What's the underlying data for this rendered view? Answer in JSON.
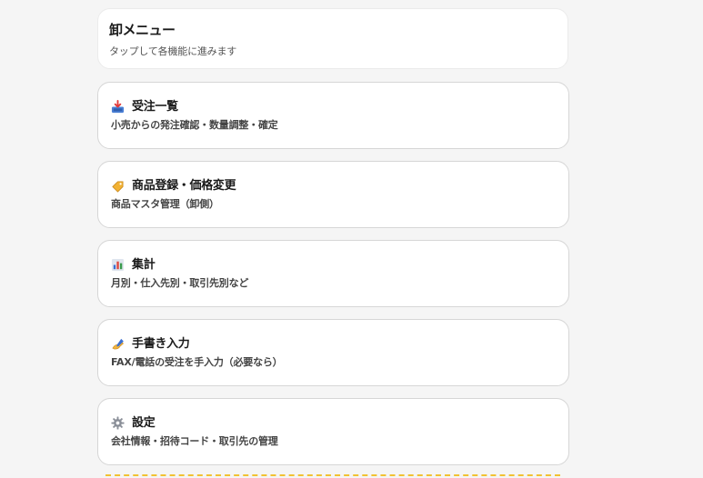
{
  "header": {
    "title": "卸メニュー",
    "subtitle": "タップして各機能に進みます"
  },
  "menu": [
    {
      "icon": "inbox-tray-icon",
      "title": "受注一覧",
      "desc": "小売からの発注確認・数量調整・確定"
    },
    {
      "icon": "price-tag-icon",
      "title": "商品登録・価格変更",
      "desc": "商品マスタ管理（卸側）"
    },
    {
      "icon": "bar-chart-icon",
      "title": "集計",
      "desc": "月別・仕入先別・取引先別など"
    },
    {
      "icon": "writing-hand-icon",
      "title": "手書き入力",
      "desc": "FAX/電話の受注を手入力（必要なら）"
    },
    {
      "icon": "gear-icon",
      "title": "設定",
      "desc": "会社情報・招待コード・取引先の管理"
    }
  ],
  "colors": {
    "background": "#f5f5f5",
    "card": "#ffffff",
    "border": "#d6d6d6",
    "dashed_accent": "#f1c232"
  }
}
